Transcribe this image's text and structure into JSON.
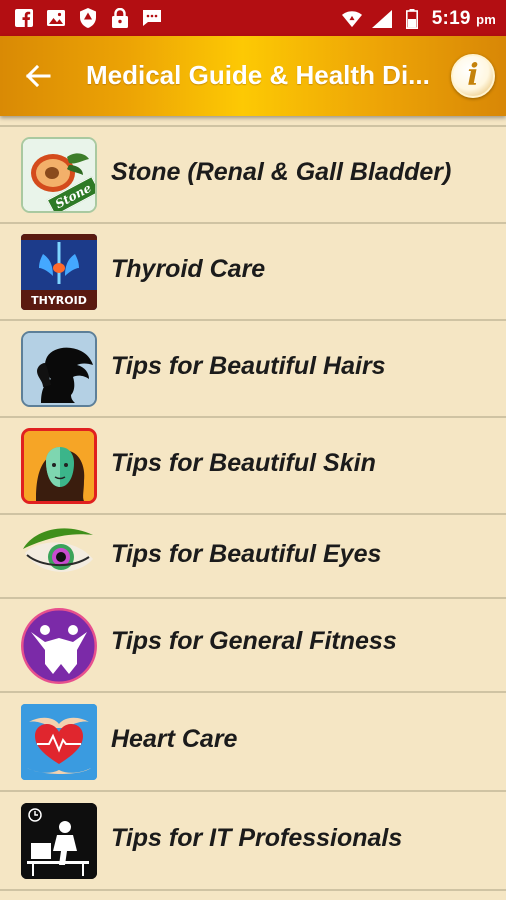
{
  "status_bar": {
    "time": "5:19",
    "time_suffix": "pm",
    "left_icons": [
      "facebook-icon",
      "image-icon",
      "shield-icon",
      "lock-icon",
      "message-icon"
    ],
    "right_icons": [
      "wifi-icon",
      "signal-icon",
      "battery-icon"
    ]
  },
  "app_bar": {
    "title": "Medical Guide & Health Di...",
    "back_icon": "arrow-left-icon",
    "info_label": "i"
  },
  "colors": {
    "status_bar": "#b30e12",
    "app_bar_center": "#fdc904",
    "app_bar_edge": "#d98a05",
    "background": "#f5e6c4",
    "divider": "#cfc3a3",
    "text": "#1b1b1b"
  },
  "items": [
    {
      "label": "Stone (Renal & Gall Bladder)",
      "icon": "kidney-stone-icon",
      "badge": "Stone"
    },
    {
      "label": "Thyroid Care",
      "icon": "thyroid-icon",
      "badge": "THYROID"
    },
    {
      "label": "Tips for Beautiful Hairs",
      "icon": "hair-icon"
    },
    {
      "label": "Tips for Beautiful Skin",
      "icon": "skin-face-icon"
    },
    {
      "label": "Tips for Beautiful Eyes",
      "icon": "eye-icon"
    },
    {
      "label": "Tips for General Fitness",
      "icon": "fitness-icon"
    },
    {
      "label": "Heart Care",
      "icon": "heart-care-icon"
    },
    {
      "label": "Tips for IT Professionals",
      "icon": "it-professional-icon"
    }
  ]
}
